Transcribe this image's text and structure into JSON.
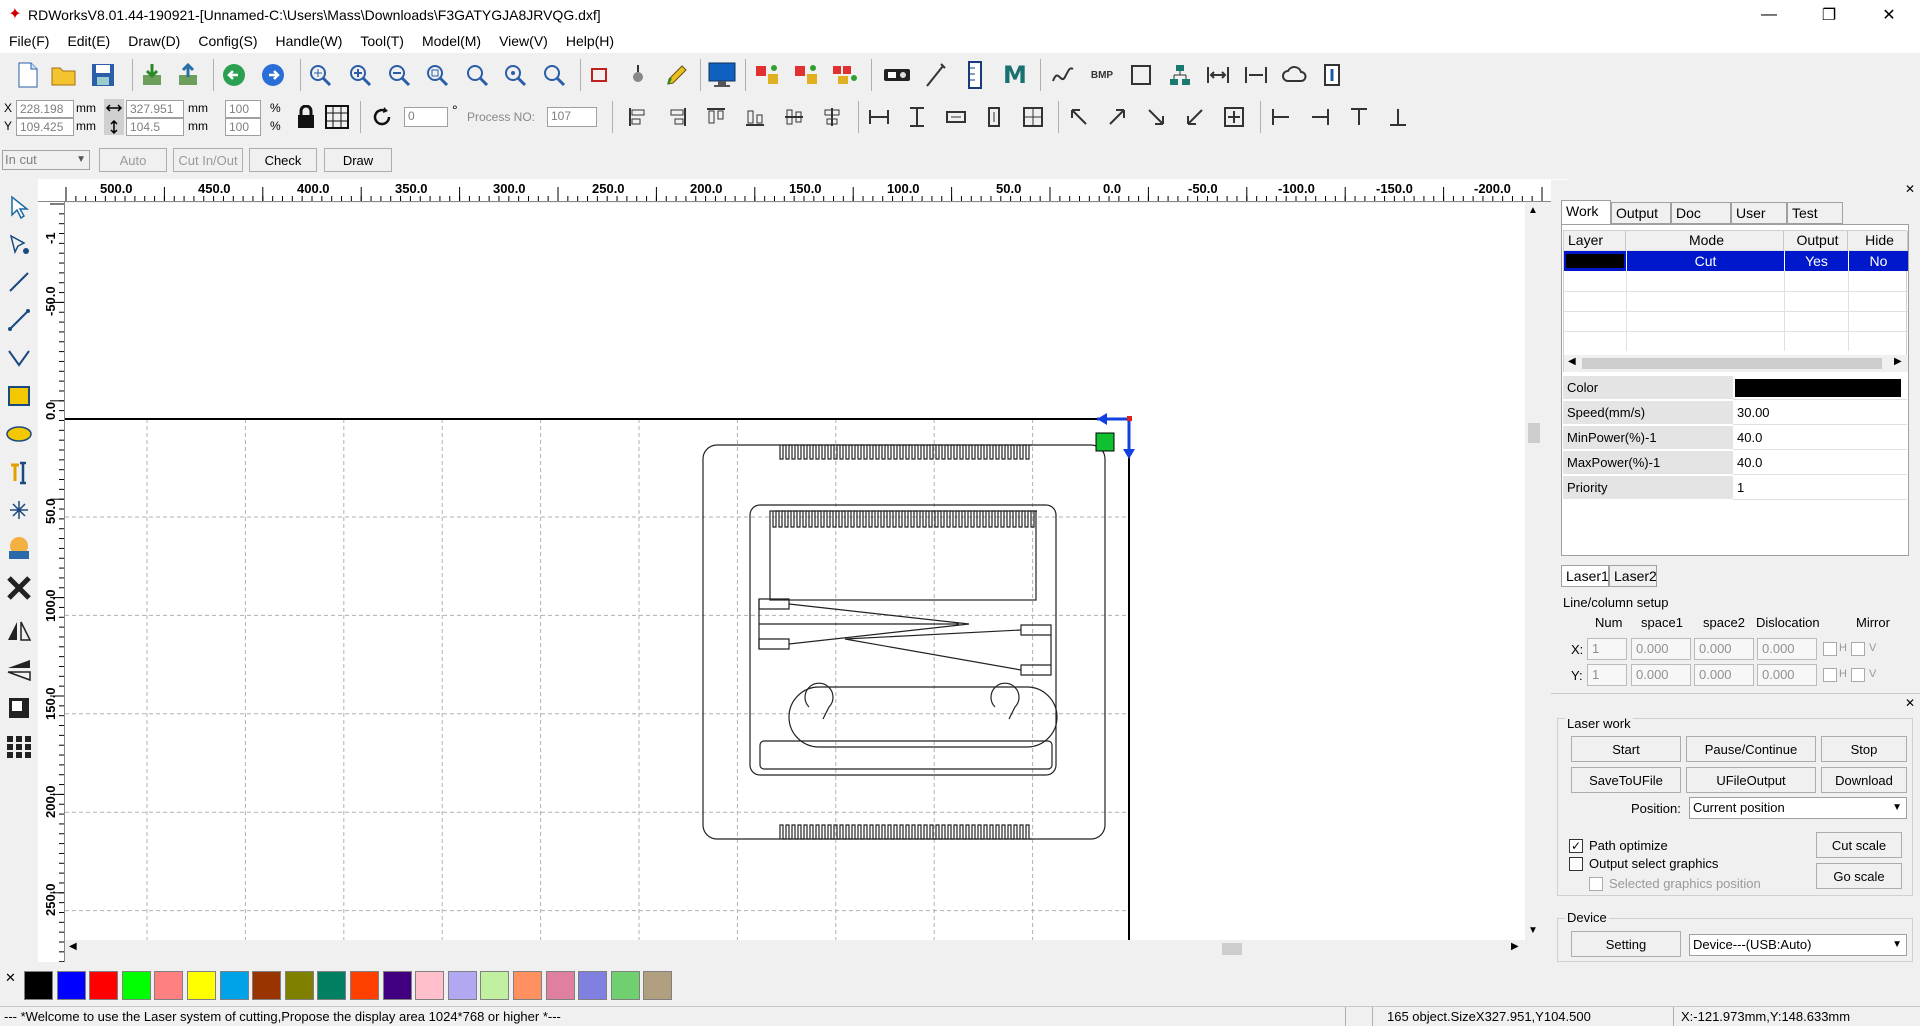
{
  "window": {
    "title": "RDWorksV8.01.44-190921-[Unnamed-C:\\Users\\Mass\\Downloads\\F3GATYGJA8JRVQG.dxf]",
    "minimize": "—",
    "restore": "❐",
    "close": "✕"
  },
  "menu": [
    "File(F)",
    "Edit(E)",
    "Draw(D)",
    "Config(S)",
    "Handle(W)",
    "Tool(T)",
    "Model(M)",
    "View(V)",
    "Help(H)"
  ],
  "coords": {
    "x_label": "X",
    "x_value": "228.198",
    "y_label": "Y",
    "y_value": "109.425",
    "w_value": "327.951",
    "h_value": "104.5",
    "unit": "mm",
    "pct_x": "100",
    "pct_y": "100",
    "pct_unit": "%",
    "angle": "0",
    "deg": "°",
    "process_no_label": "Process NO:",
    "process_no": "107"
  },
  "mode_bar": {
    "mode_select": "In cut",
    "auto": "Auto",
    "cut_in_out": "Cut In/Out",
    "check": "Check",
    "draw": "Draw"
  },
  "ruler": {
    "top": [
      "500.0",
      "450.0",
      "400.0",
      "350.0",
      "300.0",
      "250.0",
      "200.0",
      "150.0",
      "100.0",
      "50.0",
      "0.0",
      "-50.0",
      "-100.0",
      "-150.0",
      "-200.0"
    ],
    "left": [
      "-1",
      "-50.0",
      "0.0",
      "50.0",
      "100.0",
      "150.0",
      "200.0",
      "250.0"
    ]
  },
  "palette": [
    "#000000",
    "#0000ff",
    "#ff0000",
    "#00ff00",
    "#ff8080",
    "#ffff00",
    "#00a2e8",
    "#993300",
    "#808000",
    "#008060",
    "#ff4000",
    "#400080",
    "#ffc0cb",
    "#b0a8f0",
    "#c0f0a0",
    "#ff9060",
    "#e080a0",
    "#8080e0",
    "#70d070",
    "#b0a080"
  ],
  "layer_panel": {
    "tabs": [
      "Work",
      "Output",
      "Doc",
      "User",
      "Test"
    ],
    "columns": [
      "Layer",
      "Mode",
      "Output",
      "Hide"
    ],
    "rows": [
      {
        "layer_color": "#000000",
        "mode": "Cut",
        "output": "Yes",
        "hide": "No"
      }
    ],
    "props": [
      {
        "label": "Color",
        "value": ""
      },
      {
        "label": "Speed(mm/s)",
        "value": "30.00"
      },
      {
        "label": "MinPower(%)-1",
        "value": "40.0"
      },
      {
        "label": "MaxPower(%)-1",
        "value": "40.0"
      },
      {
        "label": "Priority",
        "value": "1"
      }
    ],
    "laser_tabs": [
      "Laser1",
      "Laser2"
    ],
    "line_column": {
      "title": "Line/column setup",
      "headers": [
        "Num",
        "space1",
        "space2",
        "Dislocation",
        "Mirror"
      ],
      "x_label": "X:",
      "y_label": "Y:",
      "x_values": [
        "1",
        "0.000",
        "0.000",
        "0.000"
      ],
      "y_values": [
        "1",
        "0.000",
        "0.000",
        "0.000"
      ],
      "h": "H",
      "v": "V"
    }
  },
  "laser_work": {
    "title": "Laser work",
    "start": "Start",
    "pause": "Pause/Continue",
    "stop": "Stop",
    "save_u": "SaveToUFile",
    "ufile_output": "UFileOutput",
    "download": "Download",
    "position_label": "Position:",
    "position_value": "Current position",
    "path_optimize": "Path optimize",
    "output_select": "Output select graphics",
    "selected_pos": "Selected graphics position",
    "cut_scale": "Cut scale",
    "go_scale": "Go scale"
  },
  "device": {
    "title": "Device",
    "setting": "Setting",
    "device_value": "Device---(USB:Auto)"
  },
  "status": {
    "message": "--- *Welcome to use the Laser system of cutting,Propose the display area 1024*768 or higher *---",
    "objects": "165 object.SizeX327.951,Y104.500",
    "cursor": "X:-121.973mm,Y:148.633mm"
  }
}
